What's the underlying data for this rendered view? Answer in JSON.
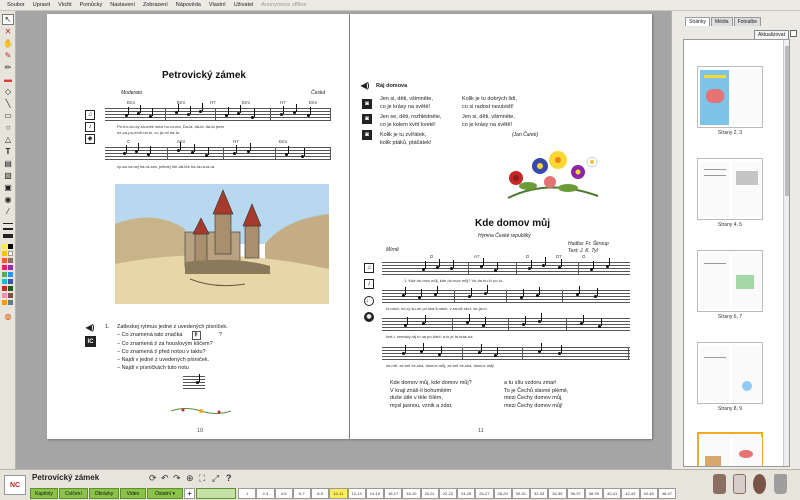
{
  "menu": [
    "Soubor",
    "Upravit",
    "Vložit",
    "Pomůcky",
    "Nastavení",
    "Zobrazení",
    "Nápověda",
    "Vlastní",
    "Uživatel",
    "Anonymous offline"
  ],
  "left_page": {
    "title": "Petrovický zámek",
    "tempo": "Moderato",
    "origin": "Česká",
    "lyrics": [
      "Pe-tro-vic-ký zá-mek mezi ho-ra-ma,    Da-la, da-la, da-la jsem",
      "ne-za-po-mně-na to, co jsi mi da-la.",
      "vy-sa-va-nej ha-ra-ses, pěknej hle-dá-tek tra-la-ra-la-ra."
    ],
    "chords_row1": [
      "Emi",
      "Emi",
      "H7",
      "Emi",
      "H7",
      "Emi"
    ],
    "chords_row2": [
      "C",
      "Ami",
      "H7",
      "Emi"
    ],
    "exercise_number": "1.",
    "exercise": [
      "Zatleskej rytmus jedné z uvedených písniček.",
      "– Co znamená tato značka",
      "– Co znamená ♯ za houslovým klíčem?",
      "– Co znamená ♯ před notou v taktu?",
      "– Najdi v jedné z uvedených písniček.",
      "– Najdi v písničkách tuto notu"
    ],
    "question_mark": "?",
    "page_number": "10"
  },
  "right_page": {
    "poem_title": "Ráj domova",
    "poem_left": [
      "Jen si, děti, všimněte,",
      "co je krásy na světě!",
      "Jen se, děti, rozhlédněte,",
      "co je kolem kvítí kveté!",
      "Kolik je tu zvířátek,",
      "kolik ptáků, ptáčátek!"
    ],
    "poem_right": [
      "Kolik je tu dobrých lidí,",
      "co si radost nezávidí!",
      "Jen si, děti, všimněte,",
      "co je krásy na světě!"
    ],
    "poem_author": "(Jan Čarek)",
    "song_title": "Kde domov můj",
    "song_subtitle": "Hymna České republiky",
    "music_credit": "Hudba: Fr. Škroup",
    "text_credit": "Text: J. K. Tyl",
    "tempo": "Mírně",
    "chords": [
      "D",
      "A7",
      "D",
      "D7",
      "G"
    ],
    "lyrics": [
      "1. Kde do-mov můj, kde do-mov můj?  Vo-da hu-čí po lu-",
      "či-nách, bo-ry šu-mí po ska-li-nách, v sa-dě skví- se ja-ro",
      "kvě-t, zemský ráj to na po-hled;  a to je ta krás-ná",
      "ze-mě, ze-mě če-ská, domov můj, ze-mě če-ská, domov můj!"
    ],
    "verse_left": [
      "Kde domov můj, kde domov můj?",
      "V kraji znáš-li bohumilém",
      "duše útlé v těle čilém,",
      "mysl jasnou, vznik a zdar,"
    ],
    "verse_right": [
      "a tu sílu vzdoru zmar!",
      "To je Čechů slavné plémě,",
      "mezi Čechy domov můj,",
      "mezi Čechy domov můj!"
    ],
    "page_number": "11"
  },
  "panel": {
    "tabs": [
      "Stránky",
      "Média",
      "Fotoalbe"
    ],
    "refresh_label": "Aktualizovat",
    "thumb_labels": [
      "Strany 2, 3",
      "Strany 4, 5",
      "Strany 6, 7",
      "Strany 8, 9"
    ]
  },
  "bottom": {
    "doc_title": "Petrovický zámek",
    "logo_text": "NC",
    "tabs": [
      "Kapitoly",
      "Cvičení",
      "Obrázky",
      "Video",
      "Ostatní ▾"
    ],
    "add_icon": "+",
    "timeline": [
      "1",
      "2-3",
      "4-5",
      "6-7",
      "8-9",
      "10-11",
      "12-13",
      "14-15",
      "16-17",
      "18-19",
      "20-21",
      "22-23",
      "24-25",
      "26-27",
      "28-29",
      "30-31",
      "32-33",
      "34-35",
      "36-37",
      "38-39",
      "40-41",
      "42-43",
      "44-45",
      "46-47"
    ],
    "current_index": 5
  },
  "colors": {
    "accent_green": "#8bc34a",
    "highlight_yellow": "#ffee58"
  }
}
